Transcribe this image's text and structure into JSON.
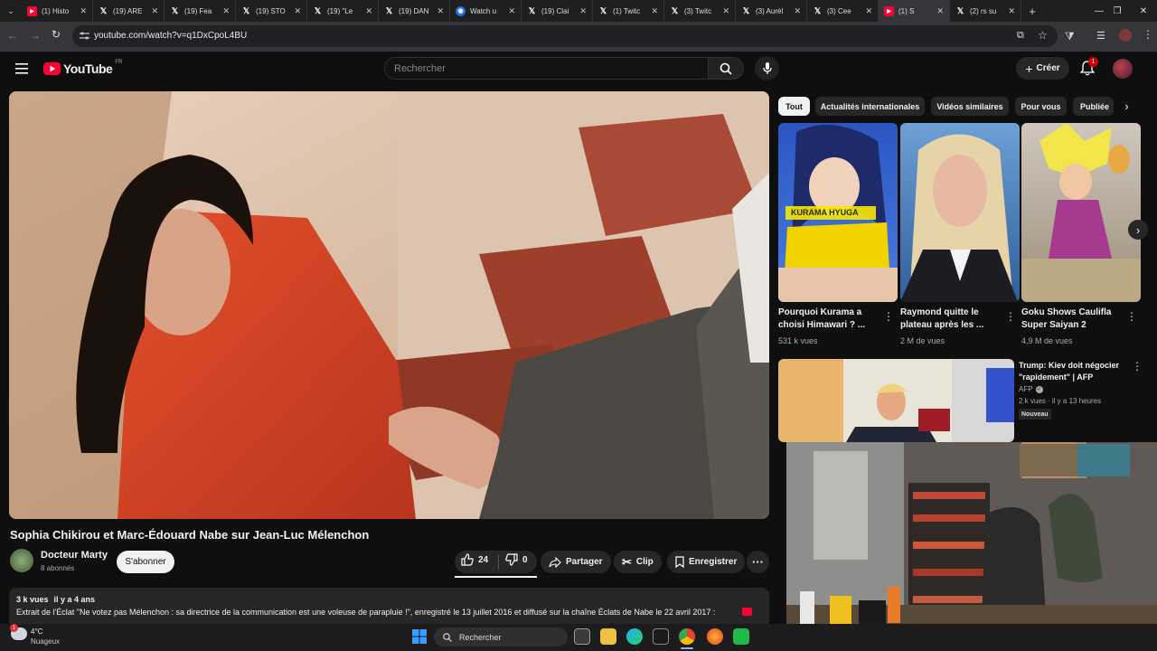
{
  "browser": {
    "tabs": [
      {
        "icon": "youtube-icon",
        "title": "(1) Histo"
      },
      {
        "icon": "x-icon",
        "title": "(19) ARE"
      },
      {
        "icon": "x-icon",
        "title": "(19) Fea"
      },
      {
        "icon": "x-icon",
        "title": "(19) STO"
      },
      {
        "icon": "x-icon",
        "title": "(19) \"Le"
      },
      {
        "icon": "x-icon",
        "title": "(19) DAN"
      },
      {
        "icon": "globe-icon",
        "title": "Watch u"
      },
      {
        "icon": "x-icon",
        "title": "(19) Clai"
      },
      {
        "icon": "x-icon",
        "title": "(1) Twitc"
      },
      {
        "icon": "x-icon",
        "title": "(3) Twitc"
      },
      {
        "icon": "x-icon",
        "title": "(3) Aurél"
      },
      {
        "icon": "x-icon",
        "title": "(3) Cee"
      },
      {
        "icon": "youtube-icon",
        "title": "(1) S"
      },
      {
        "icon": "x-icon",
        "title": "(2) rs su"
      }
    ],
    "url": "youtube.com/watch?v=q1DxCpoL4BU"
  },
  "youtube": {
    "logo_text": "YouTube",
    "region": "FR",
    "search_placeholder": "Rechercher",
    "create_label": "Créer",
    "notification_count": "1"
  },
  "video": {
    "title": "Sophia Chikirou et Marc-Édouard Nabe sur Jean-Luc Mélenchon",
    "channel_name": "Docteur Marty",
    "subscribers": "8 abonnés",
    "subscribe_label": "S'abonner",
    "likes": "24",
    "dislikes": "0",
    "share_label": "Partager",
    "clip_label": "Clip",
    "save_label": "Enregistrer",
    "views": "3 k vues",
    "age": "il y a 4 ans",
    "description": "Extrait de l'Éclat \"Ne votez pas Mélenchon : sa directrice de la communication est une voleuse de parapluie !\", enregistré le 13 juillet 2016 et diffusé sur la chaîne Éclats de Nabe le 22 avril 2017 :"
  },
  "chips": [
    "Tout",
    "Actualités internationales",
    "Vidéos similaires",
    "Pour vous",
    "Publiée"
  ],
  "shorts": [
    {
      "title_line1": "Pourquoi Kurama a",
      "title_line2": "choisi Himawari ? ...",
      "views": "531 k vues",
      "overlay": "KURAMA HYUGA"
    },
    {
      "title_line1": "Raymond quitte le",
      "title_line2": "plateau après les ...",
      "views": "2 M de vues"
    },
    {
      "title_line1": "Goku Shows Caulifla",
      "title_line2": "Super Saiyan 2",
      "views": "4,9 M de vues"
    }
  ],
  "recommended": {
    "title_line1": "Trump: Kiev doit négocier",
    "title_line2": "\"rapidement\" | AFP",
    "channel": "AFP",
    "meta": "2 k vues · il y a 13 heures",
    "badge": "Nouveau"
  },
  "taskbar": {
    "temperature": "4°C",
    "weather": "Nuageux",
    "search_placeholder": "Rechercher",
    "weather_badge": "1"
  },
  "colors": {
    "youtube_red": "#ff0033",
    "background": "#0f0f0f",
    "chip_bg": "#272727"
  }
}
